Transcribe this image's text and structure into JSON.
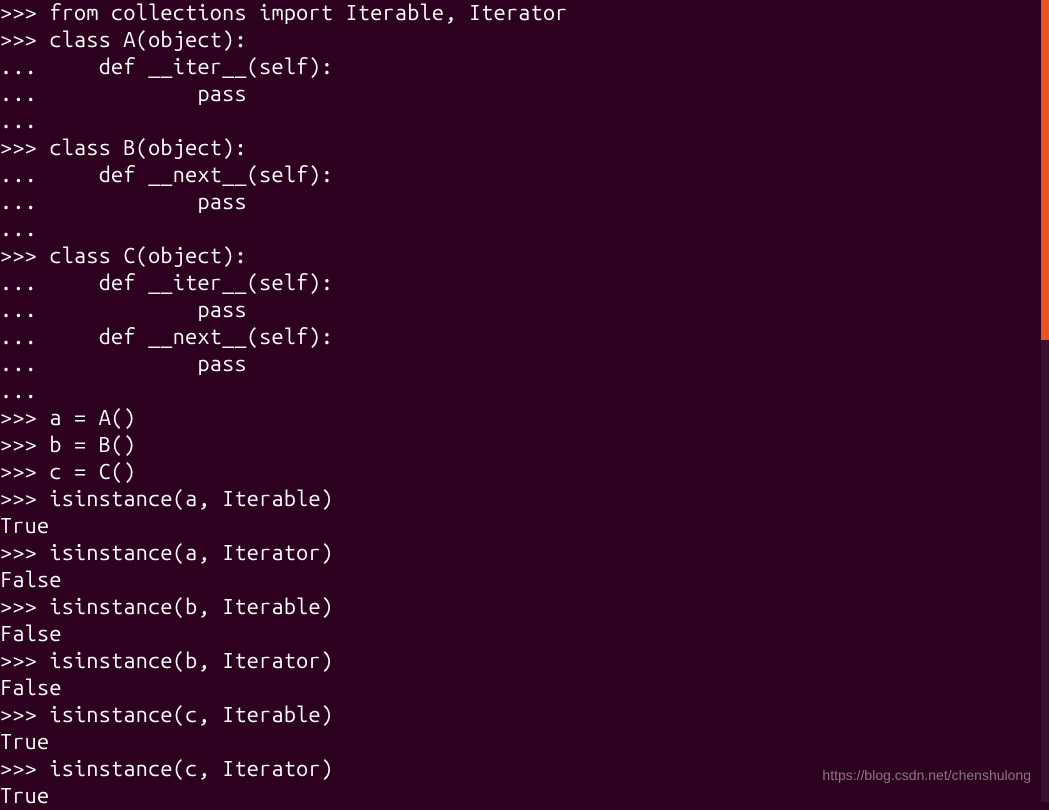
{
  "terminal": {
    "lines": [
      ">>> from collections import Iterable, Iterator",
      ">>> class A(object):",
      "...     def __iter__(self):",
      "...             pass",
      "... ",
      ">>> class B(object):",
      "...     def __next__(self):",
      "...             pass",
      "... ",
      ">>> class C(object):",
      "...     def __iter__(self):",
      "...             pass",
      "...     def __next__(self):",
      "...             pass",
      "... ",
      ">>> a = A()",
      ">>> b = B()",
      ">>> c = C()",
      ">>> isinstance(a, Iterable)",
      "True",
      ">>> isinstance(a, Iterator)",
      "False",
      ">>> isinstance(b, Iterable)",
      "False",
      ">>> isinstance(b, Iterator)",
      "False",
      ">>> isinstance(c, Iterable)",
      "True",
      ">>> isinstance(c, Iterator)",
      "True"
    ]
  },
  "watermark": {
    "text": "https://blog.csdn.net/chenshulong"
  },
  "colors": {
    "background": "#2c001e",
    "text": "#ffffff",
    "scrollbar_thumb": "#e95420"
  }
}
